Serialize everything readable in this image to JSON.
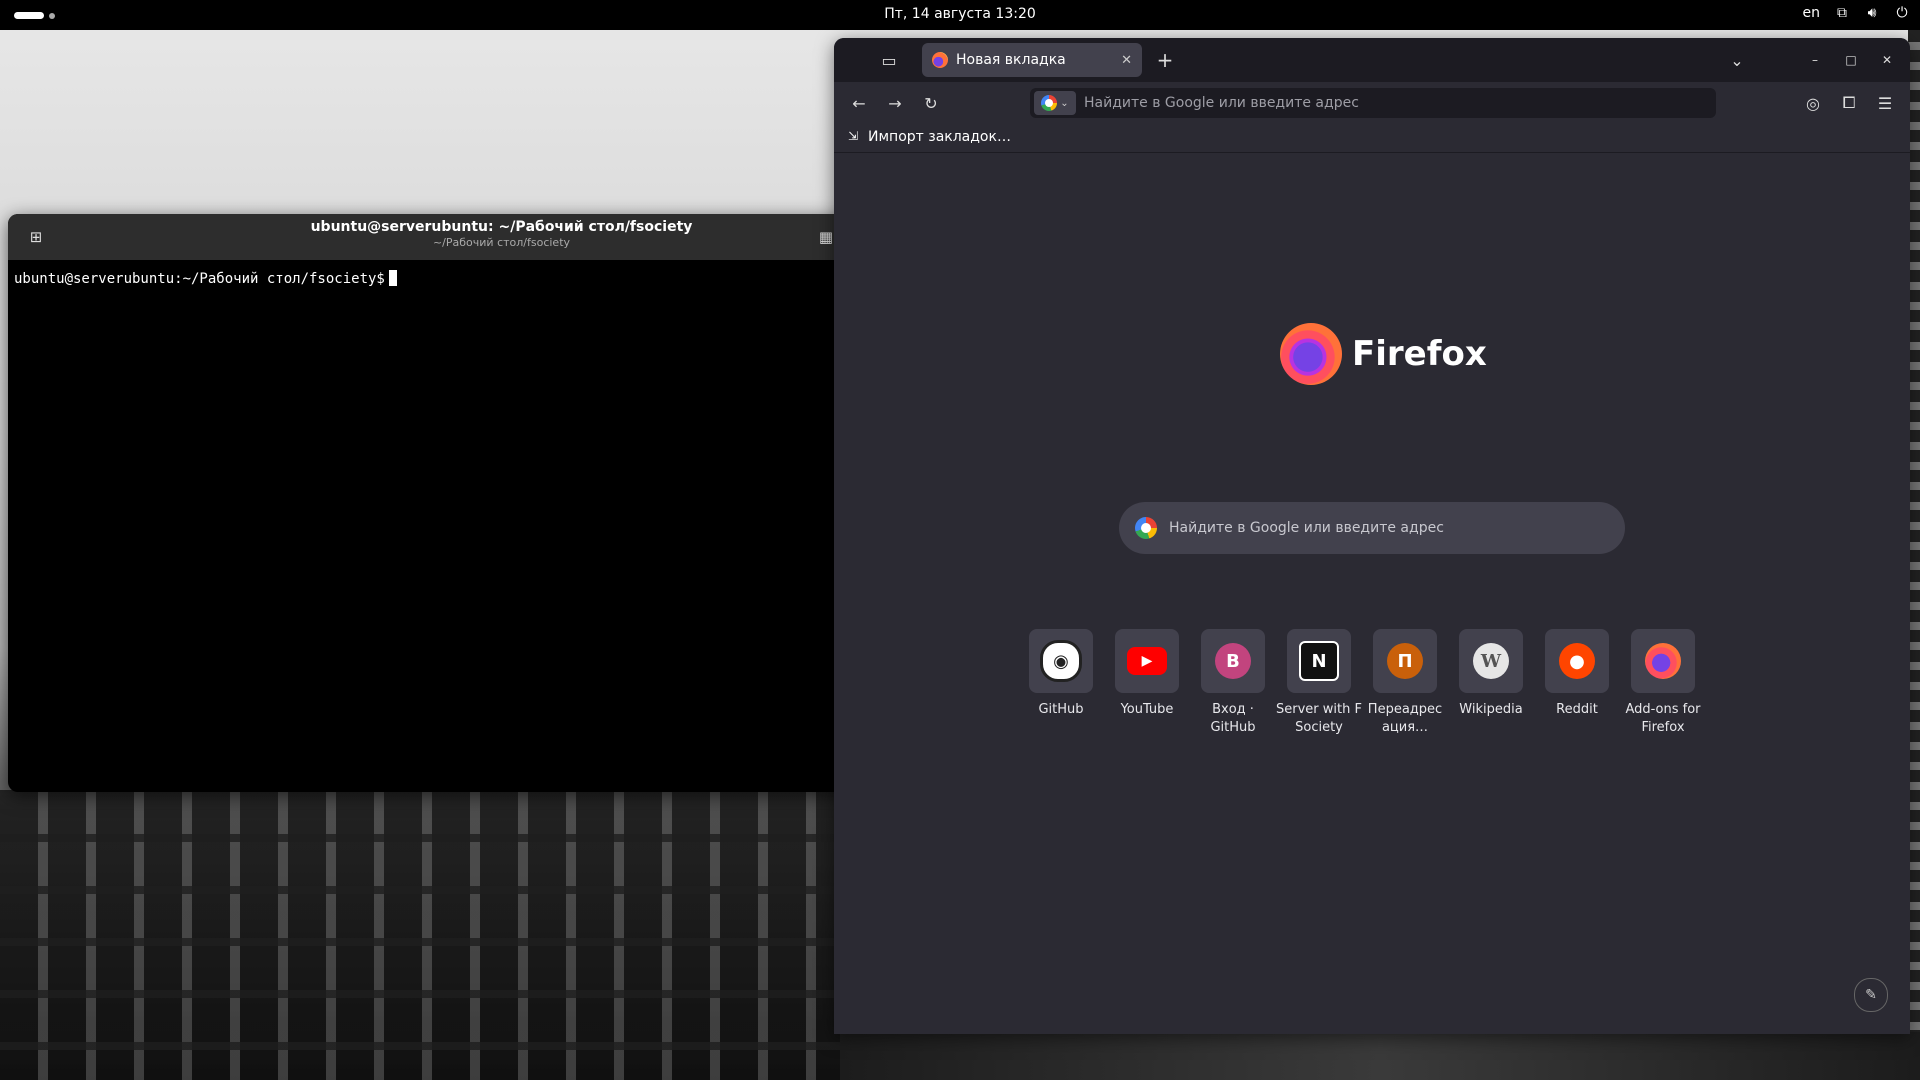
{
  "topbar": {
    "clock": "Пт, 14 августа  13:20",
    "lang": "en"
  },
  "terminal": {
    "title": "ubuntu@serverubuntu: ~/Рабочий стол/fsociety",
    "subtitle": "~/Рабочий стол/fsociety",
    "prompt": "ubuntu@serverubuntu:~/Рабочий стол/fsociety$"
  },
  "firefox": {
    "tab_label": "Новая вкладка",
    "url_placeholder": "Найдите в Google или введите адрес",
    "bookmark_import": "Импорт закладок…",
    "wordmark": "Firefox",
    "search_placeholder": "Найдите в Google или введите адрес",
    "shortcuts": [
      {
        "label": "GitHub",
        "icon": "github-icon",
        "color": "#ffffff",
        "glyph": ""
      },
      {
        "label": "YouTube",
        "icon": "youtube-icon",
        "color": "#ff0000",
        "glyph": "▶"
      },
      {
        "label": "Вход · GitHub",
        "icon": "letter-b-icon",
        "color": "#c2447e",
        "glyph": "В"
      },
      {
        "label": "Server with F Society",
        "icon": "notion-icon",
        "color": "#111111",
        "glyph": "N"
      },
      {
        "label": "Переадрес ация…",
        "icon": "letter-p-icon",
        "color": "#c9600a",
        "glyph": "П"
      },
      {
        "label": "Wikipedia",
        "icon": "wikipedia-icon",
        "color": "#e6e6e6",
        "glyph": "W"
      },
      {
        "label": "Reddit",
        "icon": "reddit-icon",
        "color": "#ff4500",
        "glyph": "●"
      },
      {
        "label": "Add-ons for Firefox",
        "icon": "firefox-addons-icon",
        "color": "#7542e5",
        "glyph": ""
      }
    ]
  }
}
